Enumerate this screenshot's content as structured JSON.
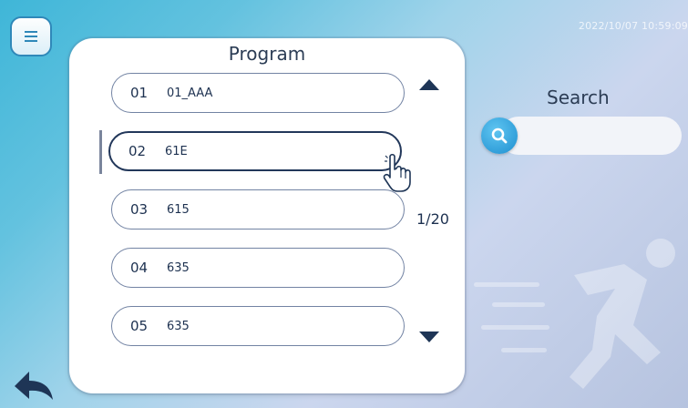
{
  "datetime": "2022/10/07  10:59:09",
  "program": {
    "title": "Program",
    "page_indicator": "1/20",
    "selected_index": 1,
    "rows": [
      {
        "num": "01",
        "name": "01_AAA"
      },
      {
        "num": "02",
        "name": "61E"
      },
      {
        "num": "03",
        "name": "615"
      },
      {
        "num": "04",
        "name": "635"
      },
      {
        "num": "05",
        "name": "635"
      }
    ]
  },
  "search": {
    "label": "Search",
    "value": "",
    "placeholder": ""
  },
  "icons": {
    "menu": "menu-icon",
    "scroll_up": "triangle-up-icon",
    "scroll_down": "triangle-down-icon",
    "search": "magnifier-icon",
    "back": "back-arrow-icon",
    "cursor": "hand-pointer-icon",
    "decoration": "running-person-icon"
  },
  "colors": {
    "accent": "#2f88b9",
    "text": "#1d3150",
    "row_border": "#7283a3",
    "selected_border": "#22375a"
  }
}
